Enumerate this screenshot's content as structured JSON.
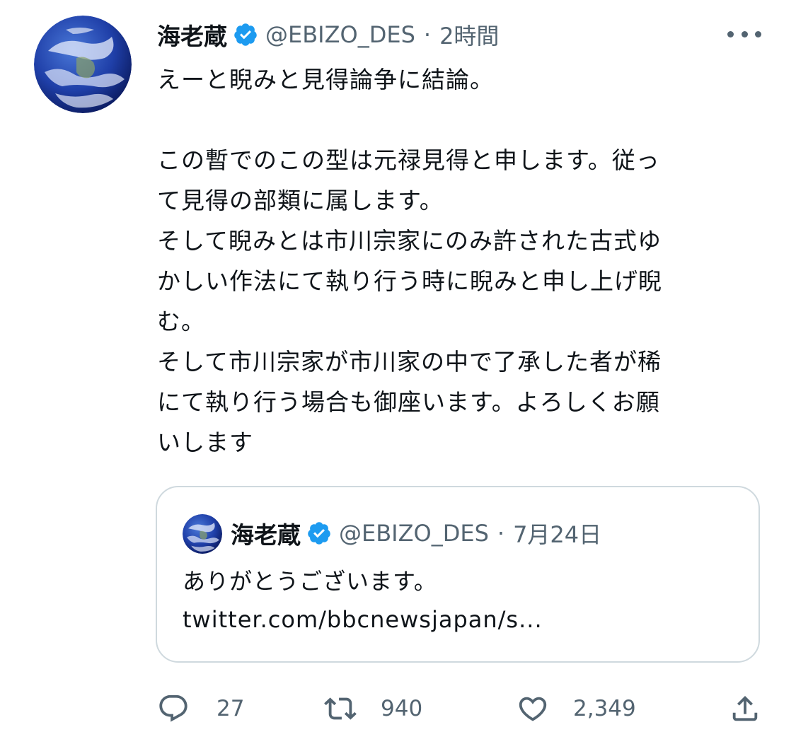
{
  "tweet": {
    "author_name": "海老蔵",
    "author_handle": "@EBIZO_DES",
    "separator": "·",
    "time": "2時間",
    "verified_icon": "verified-badge-icon",
    "more_icon": "more-horizontal-icon",
    "text_lines": [
      "えーと睨みと見得論争に結論。",
      "",
      "この暫でのこの型は元禄見得と申します。従っ",
      "て見得の部類に属します。",
      "そして睨みとは市川宗家にのみ許された古式ゆ",
      "かしい作法にて執り行う時に睨みと申し上げ睨",
      "む。",
      "そして市川宗家が市川家の中で了承した者が稀",
      "にて執り行う場合も御座います。よろしくお願",
      "いします"
    ]
  },
  "quoted_tweet": {
    "author_name": "海老蔵",
    "author_handle": "@EBIZO_DES",
    "separator": "·",
    "date": "7月24日",
    "text": "ありがとうございます。",
    "link": "twitter.com/bbcnewsjapan/s..."
  },
  "actions": {
    "reply_count": "27",
    "retweet_count": "940",
    "like_count": "2,349",
    "icons": [
      "reply-icon",
      "retweet-icon",
      "like-icon",
      "share-icon"
    ]
  },
  "colors": {
    "verified": "#1d9bf0",
    "secondary_text": "#536471",
    "primary_text": "#0f1419",
    "border": "#cfd9de"
  }
}
